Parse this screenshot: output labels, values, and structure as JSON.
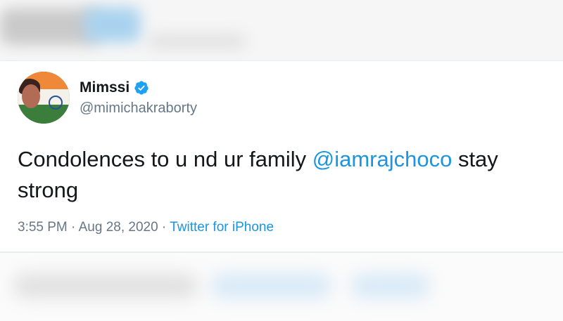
{
  "tweet": {
    "display_name": "Mimssi",
    "handle": "@mimichakraborty",
    "text_before": "Condolences to u nd ur family ",
    "mention": "@iamrajchoco",
    "text_after": " stay strong",
    "time": "3:55 PM",
    "separator": " · ",
    "date": "Aug 28, 2020",
    "source": "Twitter for iPhone"
  },
  "colors": {
    "link": "#1b95e0",
    "verified": "#1da1f2",
    "text": "#14171a",
    "secondary": "#657786"
  },
  "icons": {
    "verified": "verified-badge-icon"
  }
}
